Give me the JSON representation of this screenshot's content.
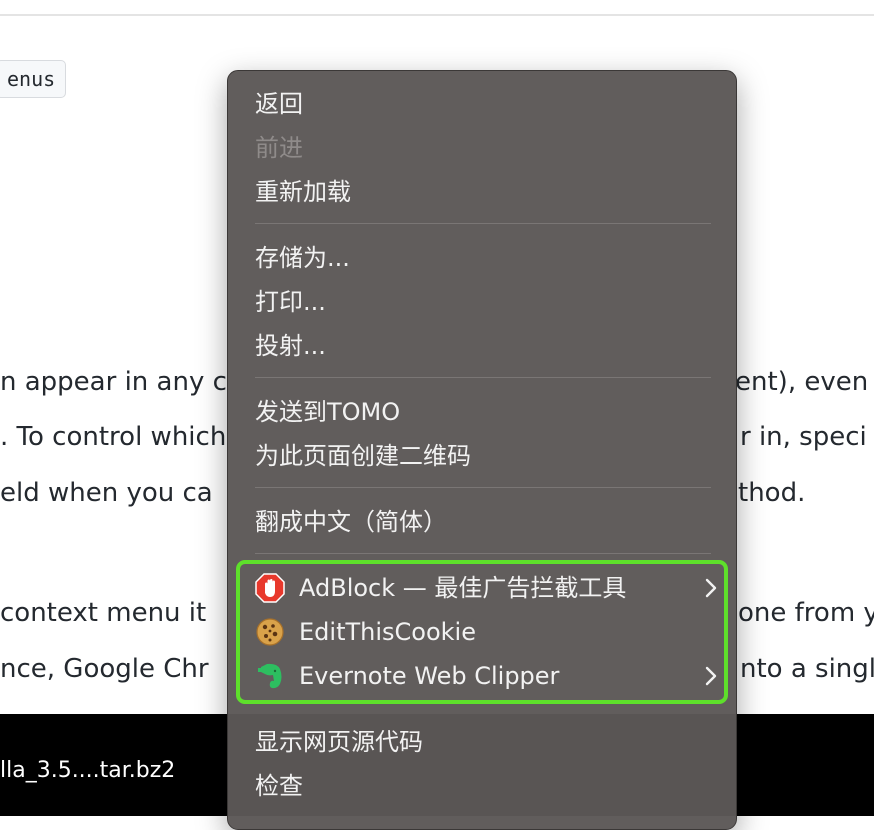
{
  "page": {
    "code_chip": "enus",
    "lines": [
      "n appear in any c",
      "ent), even",
      ". To control which",
      "r in, speci",
      "eld when you ca",
      "thod.",
      " context menu it",
      "one from y",
      "nce, Google Chr",
      "nto a singl"
    ],
    "download_label": "lla_3.5....tar.bz2"
  },
  "context_menu": {
    "back": "返回",
    "forward": "前进",
    "reload": "重新加载",
    "save_as": "存储为...",
    "print": "打印...",
    "cast": "投射...",
    "send_to": "发送到TOMO",
    "qr_code": "为此页面创建二维码",
    "translate": "翻成中文（简体）",
    "extensions": [
      {
        "label": "AdBlock — 最佳广告拦截工具",
        "icon": "adblock-hand-icon",
        "submenu": true
      },
      {
        "label": "EditThisCookie",
        "icon": "cookie-icon",
        "submenu": false
      },
      {
        "label": "Evernote Web Clipper",
        "icon": "evernote-elephant-icon",
        "submenu": true
      }
    ],
    "view_source": "显示网页源代码",
    "inspect": "检查",
    "highlight_color": "#5ee02b"
  }
}
